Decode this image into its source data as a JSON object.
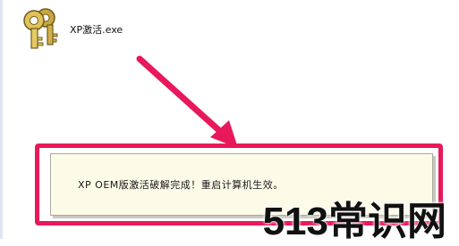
{
  "desktop": {
    "file_label": "XP激活.exe",
    "file_icon": "keys-icon"
  },
  "dialog": {
    "message": "XP OEM版激活破解完成！重启计算机生效。"
  },
  "watermark": {
    "text": "513常识网"
  },
  "colors": {
    "accent": "#e8195a",
    "dialog_bg": "#fbfbe8"
  }
}
